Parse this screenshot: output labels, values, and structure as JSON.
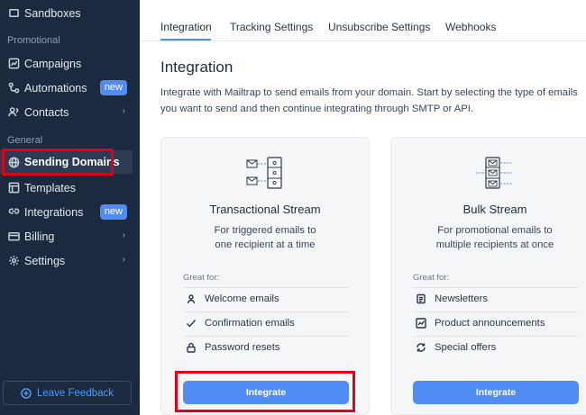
{
  "sidebar": {
    "sandboxes": "Sandboxes",
    "section_promotional": "Promotional",
    "campaigns": "Campaigns",
    "automations": "Automations",
    "automations_badge": "new",
    "contacts": "Contacts",
    "section_general": "General",
    "sending_domains": "Sending Domains",
    "templates": "Templates",
    "integrations": "Integrations",
    "integrations_badge": "new",
    "billing": "Billing",
    "settings": "Settings",
    "feedback": "Leave Feedback"
  },
  "tabs": [
    "Integration",
    "Tracking Settings",
    "Unsubscribe Settings",
    "Webhooks"
  ],
  "main": {
    "title": "Integration",
    "description": "Integrate with Mailtrap to send emails from your domain. Start by selecting the type of emails you want to send and then continue integrating through SMTP or API."
  },
  "cards": [
    {
      "title": "Transactional Stream",
      "subtitle_line1": "For triggered emails to",
      "subtitle_line2": "one recipient at a time",
      "great_for": "Great for:",
      "features": [
        "Welcome emails",
        "Confirmation emails",
        "Password resets"
      ],
      "button": "Integrate"
    },
    {
      "title": "Bulk Stream",
      "subtitle_line1": "For promotional emails to",
      "subtitle_line2": "multiple recipients at once",
      "great_for": "Great for:",
      "features": [
        "Newsletters",
        "Product announcements",
        "Special offers"
      ],
      "button": "Integrate"
    }
  ],
  "colors": {
    "sidebar_bg": "#1b2a3f",
    "accent": "#4f8df5",
    "highlight": "#e0001a"
  }
}
